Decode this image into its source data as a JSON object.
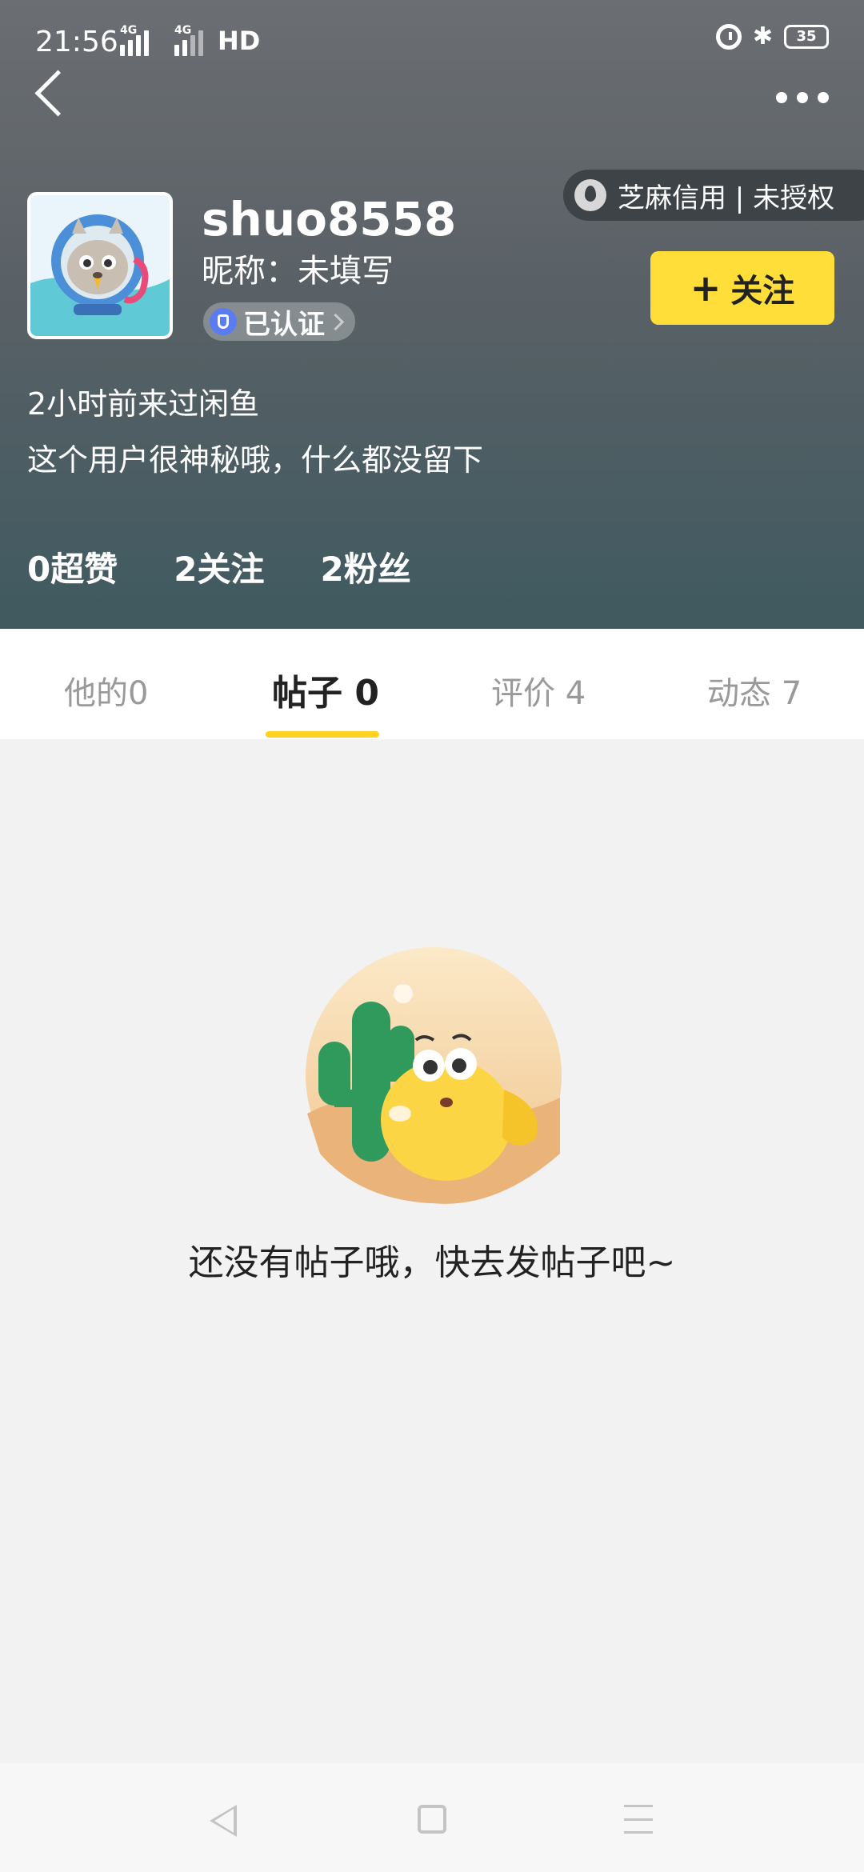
{
  "status_bar": {
    "time": "21:56",
    "net1": "4G",
    "net2": "4G",
    "hd": "HD",
    "battery": "35"
  },
  "header": {
    "sesame_credit": "芝麻信用 | 未授权",
    "username": "shuo8558",
    "nickname": "昵称：未填写",
    "verified_label": "已认证",
    "follow_label": "关注",
    "last_visit": "2小时前来过闲鱼",
    "bio": "这个用户很神秘哦，什么都没留下",
    "stats": {
      "likes": "0超赞",
      "following": "2关注",
      "fans": "2粉丝"
    }
  },
  "tabs": [
    {
      "label": "他的0",
      "active": false
    },
    {
      "label": "帖子 0",
      "active": true
    },
    {
      "label": "评价 4",
      "active": false
    },
    {
      "label": "动态 7",
      "active": false
    }
  ],
  "empty_state": {
    "message": "还没有帖子哦，快去发帖子吧~"
  },
  "colors": {
    "accent": "#ffde3a",
    "indicator": "#ffd21e",
    "verified": "#5b7cf0"
  }
}
